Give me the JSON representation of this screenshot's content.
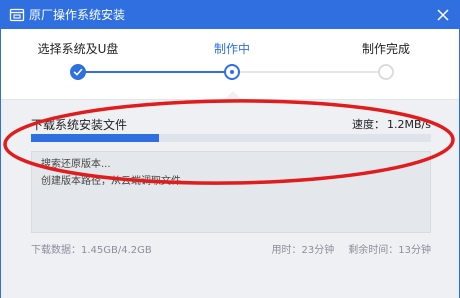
{
  "window": {
    "title": "原厂操作系统安装",
    "icons": {
      "app": "app-window-icon",
      "close": "close-icon"
    },
    "accent_color": "#2f6fe0"
  },
  "steps": [
    {
      "label": "选择系统及U盘",
      "state": "done"
    },
    {
      "label": "制作中",
      "state": "active"
    },
    {
      "label": "制作完成",
      "state": "todo"
    }
  ],
  "task": {
    "label": "下载系统安装文件",
    "speed_label": "速度：",
    "speed_value": "1.2MB/s",
    "progress": 0.32
  },
  "log": {
    "lines": [
      "搜索还原版本...",
      "创建版本路径，从云端调取文件..."
    ]
  },
  "footer": {
    "download_label": "下载数据：",
    "download_value": "1.45GB/4.2GB",
    "elapsed_label": "用时：",
    "elapsed_value": "23分钟",
    "remaining_label": "剩余时间：",
    "remaining_value": "13分钟"
  },
  "annotation": {
    "shape": "ellipse",
    "color": "#e01c1c"
  }
}
